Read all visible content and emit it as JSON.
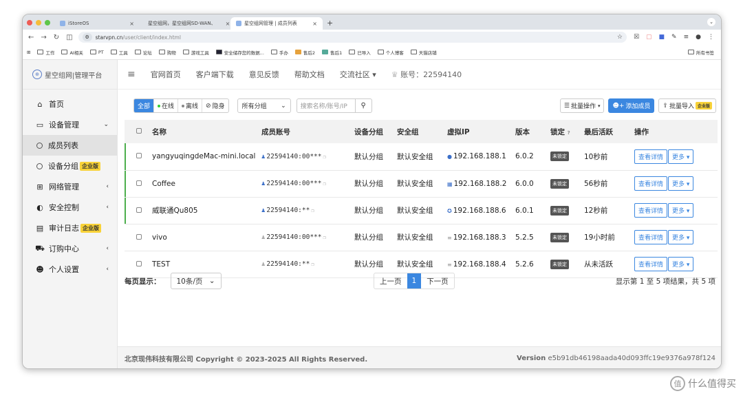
{
  "browser": {
    "tabs": [
      {
        "label": "iStoreOS",
        "close": "×"
      },
      {
        "label": "星空组网，星空组网SD-WAN、",
        "close": "×"
      },
      {
        "label": "星空组网管理 | 成员列表",
        "close": "×"
      }
    ],
    "newtab": "+",
    "url_host": "starvpn.cn",
    "url_path": "/user/client/index.html",
    "bookmarks": [
      "工作",
      "AI相关",
      "PT",
      "工具",
      "论坛",
      "购物",
      "游戏工具",
      "安全储存您的数据...",
      "手办",
      "售后2",
      "售后1",
      "已导入",
      "个人博客",
      "天猫店铺"
    ],
    "bookmarks_right": "所有书签"
  },
  "sidebar": {
    "brand": "星空组网|管理平台",
    "items": [
      {
        "label": "首页",
        "icon": "home-icon",
        "glyph": "⌂"
      },
      {
        "label": "设备管理",
        "icon": "monitor-icon",
        "glyph": "▭",
        "caret": "⌄"
      },
      {
        "label": "成员列表"
      },
      {
        "label": "设备分组",
        "badge": "企业版"
      },
      {
        "label": "网络管理",
        "icon": "network-icon",
        "glyph": "⊞",
        "caret": "‹"
      },
      {
        "label": "安全控制",
        "icon": "shield-icon",
        "glyph": "◐",
        "caret": "‹"
      },
      {
        "label": "审计日志",
        "icon": "clipboard-icon",
        "glyph": "▤",
        "badge": "企业版"
      },
      {
        "label": "订购中心",
        "icon": "cart-icon",
        "glyph": "⛟",
        "caret": "‹"
      },
      {
        "label": "个人设置",
        "icon": "users-icon",
        "glyph": "☻",
        "caret": "‹"
      }
    ]
  },
  "topnav": {
    "links": [
      "官网首页",
      "客户端下载",
      "意见反馈",
      "帮助文档",
      "交流社区 ▾"
    ],
    "account": "账号：22594140"
  },
  "toolbar": {
    "filters": [
      "全部",
      "在线",
      "离线",
      "隐身"
    ],
    "group_select": "所有分组",
    "search_placeholder": "搜索名称/账号/IP",
    "batch_ops": "批量操作",
    "add_member": "添加成员",
    "batch_import": "批量导入",
    "batch_import_badge": "企业版"
  },
  "table": {
    "headers": [
      "名称",
      "成员账号",
      "设备分组",
      "安全组",
      "虚拟IP",
      "版本",
      "锁定",
      "最后活跃",
      "操作"
    ],
    "rows": [
      {
        "name": "yangyuqingdeMac-mini.local",
        "account": "22594140:00***",
        "group": "默认分组",
        "sec": "默认安全组",
        "ip": "192.168.188.1",
        "ver": "6.0.2",
        "lock": "未锁定",
        "last": "10秒前",
        "online": true
      },
      {
        "name": "Coffee",
        "account": "22594140:00***",
        "group": "默认分组",
        "sec": "默认安全组",
        "ip": "192.168.188.2",
        "ver": "6.0.0",
        "lock": "未锁定",
        "last": "56秒前",
        "online": true
      },
      {
        "name": "威联通Qu805",
        "account": "22594140:**",
        "group": "默认分组",
        "sec": "默认安全组",
        "ip": "192.168.188.6",
        "ver": "6.0.1",
        "lock": "未锁定",
        "last": "12秒前",
        "online": true
      },
      {
        "name": "vivo",
        "account": "22594140:00***",
        "group": "默认分组",
        "sec": "默认安全组",
        "ip": "192.168.188.3",
        "ver": "5.2.5",
        "lock": "未锁定",
        "last": "19小时前",
        "online": false
      },
      {
        "name": "TEST",
        "account": "22594140:**",
        "group": "默认分组",
        "sec": "默认安全组",
        "ip": "192.168.188.4",
        "ver": "5.2.6",
        "lock": "未锁定",
        "last": "从未活跃",
        "online": false
      }
    ],
    "detail_label": "查看详情",
    "more_label": "更多 ▾"
  },
  "pager": {
    "page_size_label": "每页显示：",
    "page_size": "10条/页",
    "prev": "上一页",
    "current": "1",
    "next": "下一页",
    "info": "显示第 1 至 5 项结果，共 5 项"
  },
  "footer": {
    "copyright": "北京现伟科技有限公司 Copyright © 2023-2025 All Rights Reserved.",
    "version_label": "Version",
    "version": "e5b91db46198aada40d093ffc19e9376a978f124"
  },
  "watermark": "什么值得买",
  "colors": {
    "accent": "#3b87e0",
    "badge": "#f8d238",
    "online_bar": "#4cae4c"
  }
}
